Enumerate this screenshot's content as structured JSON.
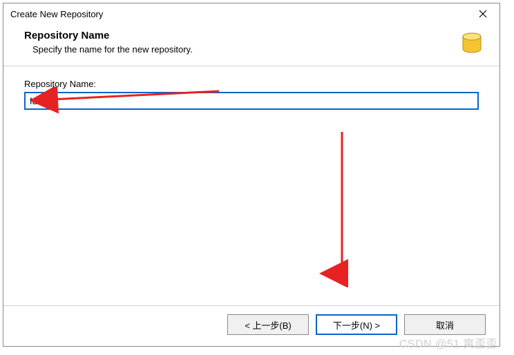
{
  "titlebar": {
    "title": "Create New Repository"
  },
  "header": {
    "heading": "Repository Name",
    "subtitle": "Specify the name for the new repository."
  },
  "form": {
    "repo_name_label": "Repository Name:",
    "repo_name_value": "fuxi"
  },
  "buttons": {
    "back": "< 上一步(B)",
    "next": "下一步(N) >",
    "cancel": "取消"
  },
  "watermark": "CSDN @51 爽歪歪"
}
